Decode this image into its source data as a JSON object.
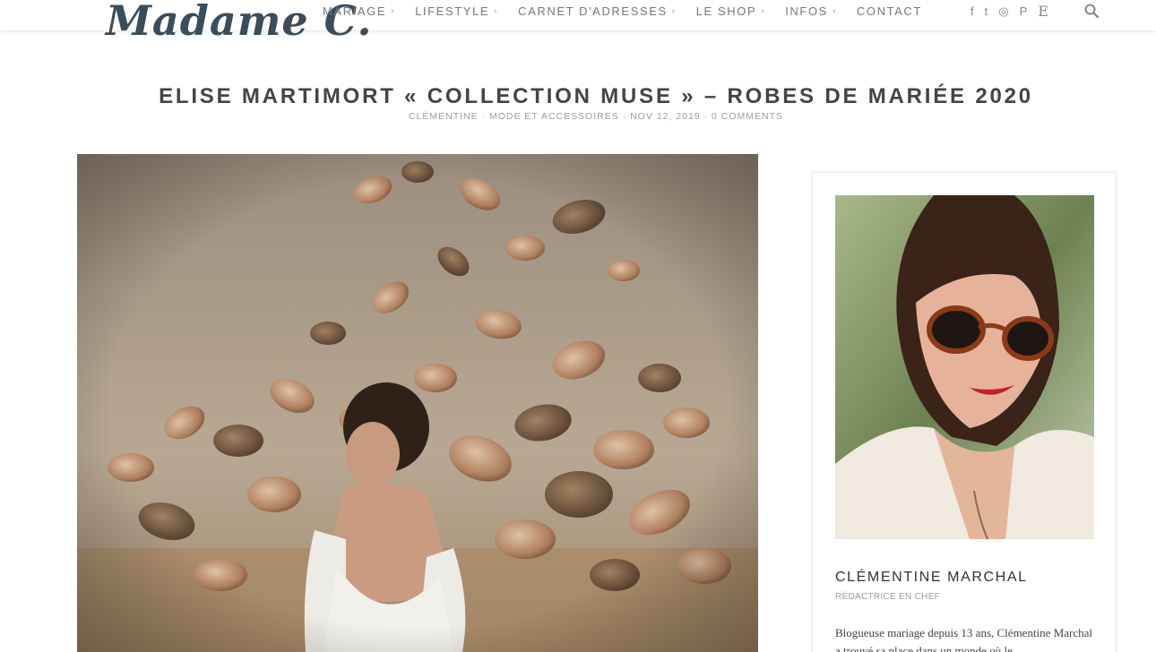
{
  "site": {
    "logo_text": "Madame C."
  },
  "nav": {
    "items": [
      {
        "label": "MARIAGE",
        "chevron": "›"
      },
      {
        "label": "LIFESTYLE",
        "chevron": "›"
      },
      {
        "label": "CARNET D'ADRESSES",
        "chevron": "›"
      },
      {
        "label": "LE SHOP",
        "chevron": "›"
      },
      {
        "label": "INFOS",
        "chevron": "›"
      },
      {
        "label": "CONTACT",
        "chevron": ""
      }
    ],
    "social_icons": [
      "facebook-icon",
      "twitter-icon",
      "instagram-icon",
      "pinterest-icon",
      "etsy-icon"
    ],
    "social_glyphs": {
      "facebook": "f",
      "twitter": "t",
      "instagram": "◎",
      "pinterest": "P",
      "etsy": "E"
    },
    "search_icon": "search-icon"
  },
  "post": {
    "title": "ELISE MARTIMORT « COLLECTION MUSE » – ROBES DE MARIÉE 2020",
    "author": "CLÉMENTINE",
    "category": "MODE ET ACCESSOIRES",
    "date": "NOV 12, 2019",
    "comments": "0 COMMENTS",
    "separator": "·"
  },
  "sidebar": {
    "name": "CLÉMENTINE MARCHAL",
    "role": "RÉDACTRICE EN CHEF",
    "bio": "Blogueuse mariage depuis 13 ans, Clémentine Marchal a trouvé sa place dans un monde où le"
  },
  "colors": {
    "accent": "#a59a8f",
    "text": "#444444",
    "logo": "#3a4d5c"
  }
}
